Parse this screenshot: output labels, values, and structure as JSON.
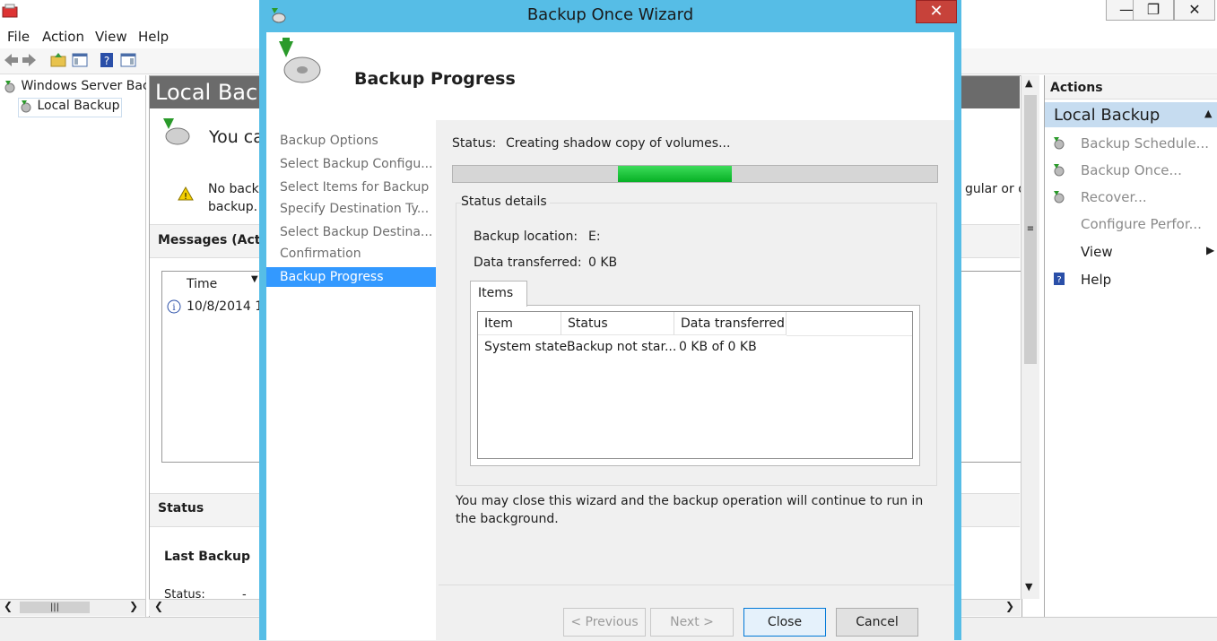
{
  "main_window": {
    "menu": [
      "File",
      "Action",
      "View",
      "Help"
    ],
    "tree": {
      "root": "Windows Server Bac",
      "child": "Local Backup"
    },
    "center": {
      "header": "Local Back",
      "welcome_text": "You ca",
      "warning_text_1": "No back",
      "warning_text_2": "backup.",
      "warning_overflow": "gular or o",
      "messages_heading": "Messages (Activ",
      "messages_col_time": "Time",
      "messages_row_time": "10/8/2014 1",
      "status_heading": "Status",
      "last_backup_heading": "Last Backup",
      "status_label": "Status:",
      "status_value": "-"
    },
    "actions": {
      "heading": "Actions",
      "section": "Local Backup",
      "items": [
        "Backup Schedule...",
        "Backup Once...",
        "Recover...",
        "Configure Perfor...",
        "View",
        "Help"
      ]
    }
  },
  "wizard": {
    "title": "Backup Once Wizard",
    "page_title": "Backup Progress",
    "nav": [
      "Backup Options",
      "Select Backup Configu...",
      "Select Items for Backup",
      "Specify Destination Ty...",
      "Select Backup Destina...",
      "Confirmation",
      "Backup Progress"
    ],
    "status_label": "Status:",
    "status_value": "Creating shadow copy of volumes...",
    "progress": {
      "type": "marquee",
      "accent": "#06b025"
    },
    "status_details": {
      "heading": "Status details",
      "backup_location_label": "Backup location:",
      "backup_location_value": "E:",
      "data_transferred_label": "Data transferred:",
      "data_transferred_value": "0 KB"
    },
    "items_tab": "Items",
    "items_table": {
      "columns": [
        "Item",
        "Status",
        "Data transferred"
      ],
      "rows": [
        [
          "System state",
          "Backup not star...",
          "0 KB of 0 KB"
        ]
      ]
    },
    "note": "You may close this wizard and the backup operation will continue to run in the background.",
    "buttons": {
      "previous": "< Previous",
      "next": "Next >",
      "close": "Close",
      "cancel": "Cancel"
    }
  }
}
